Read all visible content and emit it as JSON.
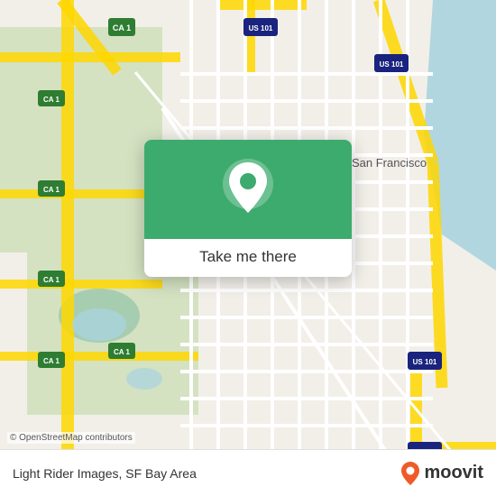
{
  "map": {
    "attribution": "© OpenStreetMap contributors",
    "location": "San Francisco",
    "bg_color": "#f2efe9"
  },
  "card": {
    "button_label": "Take me there",
    "bg_color": "#3dab6e"
  },
  "bottom_bar": {
    "location_name": "Light Rider Images, SF Bay Area",
    "moovit_label": "moovit"
  },
  "moovit_pin": {
    "color": "#f05a28"
  }
}
